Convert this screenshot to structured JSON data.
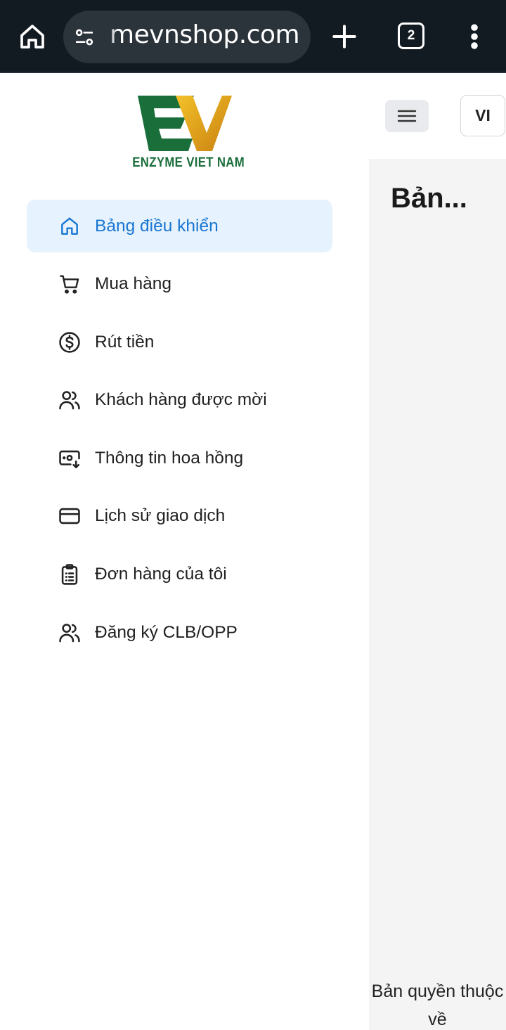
{
  "browser": {
    "url": "mevnshop.com",
    "tab_count": "2",
    "icons": [
      "home-icon",
      "site-settings-icon",
      "new-tab-icon",
      "tab-switcher-icon",
      "more-icon"
    ]
  },
  "brand": {
    "logo_text": "ENZYME VIET NAM",
    "colors": {
      "green": "#1a6e3a",
      "gold": "#e0a31a"
    }
  },
  "sidebar": {
    "items": [
      {
        "label": "Bảng điều khiển",
        "icon": "home-icon",
        "active": true
      },
      {
        "label": "Mua hàng",
        "icon": "cart-icon",
        "active": false
      },
      {
        "label": "Rút tiền",
        "icon": "dollar-circle-icon",
        "active": false
      },
      {
        "label": "Khách hàng được mời",
        "icon": "users-icon",
        "active": false
      },
      {
        "label": "Thông tin hoa hồng",
        "icon": "cash-icon",
        "active": false
      },
      {
        "label": "Lịch sử giao dịch",
        "icon": "credit-card-icon",
        "active": false
      },
      {
        "label": "Đơn hàng của tôi",
        "icon": "clipboard-icon",
        "active": false
      },
      {
        "label": "Đăng ký CLB/OPP",
        "icon": "users-icon",
        "active": false
      }
    ]
  },
  "header": {
    "language": "VI"
  },
  "main": {
    "title": "Bản...",
    "footer": "Bản quyền thuộc về"
  },
  "colors": {
    "accent": "#1976d2",
    "active_bg": "#e6f2fd",
    "browser_bg": "#121a22",
    "content_bg": "#f4f4f4"
  }
}
